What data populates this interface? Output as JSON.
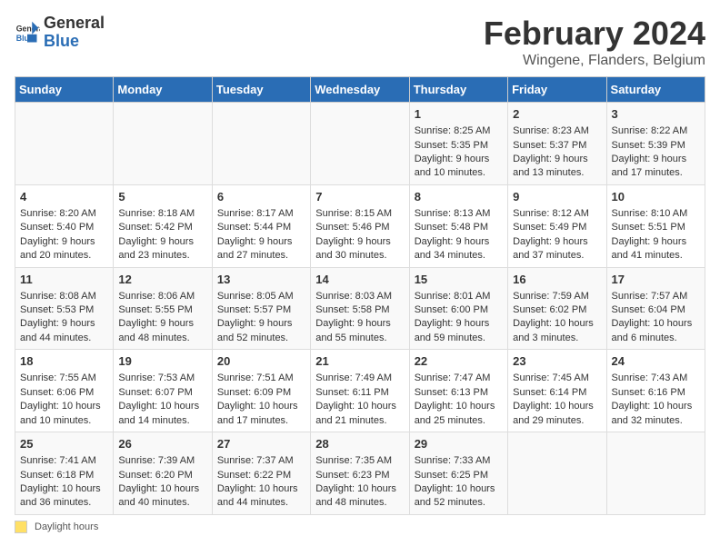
{
  "header": {
    "logo_general": "General",
    "logo_blue": "Blue",
    "title": "February 2024",
    "subtitle": "Wingene, Flanders, Belgium"
  },
  "columns": [
    "Sunday",
    "Monday",
    "Tuesday",
    "Wednesday",
    "Thursday",
    "Friday",
    "Saturday"
  ],
  "weeks": [
    {
      "days": [
        {
          "num": "",
          "info": ""
        },
        {
          "num": "",
          "info": ""
        },
        {
          "num": "",
          "info": ""
        },
        {
          "num": "",
          "info": ""
        },
        {
          "num": "1",
          "info": "Sunrise: 8:25 AM\nSunset: 5:35 PM\nDaylight: 9 hours and 10 minutes."
        },
        {
          "num": "2",
          "info": "Sunrise: 8:23 AM\nSunset: 5:37 PM\nDaylight: 9 hours and 13 minutes."
        },
        {
          "num": "3",
          "info": "Sunrise: 8:22 AM\nSunset: 5:39 PM\nDaylight: 9 hours and 17 minutes."
        }
      ]
    },
    {
      "days": [
        {
          "num": "4",
          "info": "Sunrise: 8:20 AM\nSunset: 5:40 PM\nDaylight: 9 hours and 20 minutes."
        },
        {
          "num": "5",
          "info": "Sunrise: 8:18 AM\nSunset: 5:42 PM\nDaylight: 9 hours and 23 minutes."
        },
        {
          "num": "6",
          "info": "Sunrise: 8:17 AM\nSunset: 5:44 PM\nDaylight: 9 hours and 27 minutes."
        },
        {
          "num": "7",
          "info": "Sunrise: 8:15 AM\nSunset: 5:46 PM\nDaylight: 9 hours and 30 minutes."
        },
        {
          "num": "8",
          "info": "Sunrise: 8:13 AM\nSunset: 5:48 PM\nDaylight: 9 hours and 34 minutes."
        },
        {
          "num": "9",
          "info": "Sunrise: 8:12 AM\nSunset: 5:49 PM\nDaylight: 9 hours and 37 minutes."
        },
        {
          "num": "10",
          "info": "Sunrise: 8:10 AM\nSunset: 5:51 PM\nDaylight: 9 hours and 41 minutes."
        }
      ]
    },
    {
      "days": [
        {
          "num": "11",
          "info": "Sunrise: 8:08 AM\nSunset: 5:53 PM\nDaylight: 9 hours and 44 minutes."
        },
        {
          "num": "12",
          "info": "Sunrise: 8:06 AM\nSunset: 5:55 PM\nDaylight: 9 hours and 48 minutes."
        },
        {
          "num": "13",
          "info": "Sunrise: 8:05 AM\nSunset: 5:57 PM\nDaylight: 9 hours and 52 minutes."
        },
        {
          "num": "14",
          "info": "Sunrise: 8:03 AM\nSunset: 5:58 PM\nDaylight: 9 hours and 55 minutes."
        },
        {
          "num": "15",
          "info": "Sunrise: 8:01 AM\nSunset: 6:00 PM\nDaylight: 9 hours and 59 minutes."
        },
        {
          "num": "16",
          "info": "Sunrise: 7:59 AM\nSunset: 6:02 PM\nDaylight: 10 hours and 3 minutes."
        },
        {
          "num": "17",
          "info": "Sunrise: 7:57 AM\nSunset: 6:04 PM\nDaylight: 10 hours and 6 minutes."
        }
      ]
    },
    {
      "days": [
        {
          "num": "18",
          "info": "Sunrise: 7:55 AM\nSunset: 6:06 PM\nDaylight: 10 hours and 10 minutes."
        },
        {
          "num": "19",
          "info": "Sunrise: 7:53 AM\nSunset: 6:07 PM\nDaylight: 10 hours and 14 minutes."
        },
        {
          "num": "20",
          "info": "Sunrise: 7:51 AM\nSunset: 6:09 PM\nDaylight: 10 hours and 17 minutes."
        },
        {
          "num": "21",
          "info": "Sunrise: 7:49 AM\nSunset: 6:11 PM\nDaylight: 10 hours and 21 minutes."
        },
        {
          "num": "22",
          "info": "Sunrise: 7:47 AM\nSunset: 6:13 PM\nDaylight: 10 hours and 25 minutes."
        },
        {
          "num": "23",
          "info": "Sunrise: 7:45 AM\nSunset: 6:14 PM\nDaylight: 10 hours and 29 minutes."
        },
        {
          "num": "24",
          "info": "Sunrise: 7:43 AM\nSunset: 6:16 PM\nDaylight: 10 hours and 32 minutes."
        }
      ]
    },
    {
      "days": [
        {
          "num": "25",
          "info": "Sunrise: 7:41 AM\nSunset: 6:18 PM\nDaylight: 10 hours and 36 minutes."
        },
        {
          "num": "26",
          "info": "Sunrise: 7:39 AM\nSunset: 6:20 PM\nDaylight: 10 hours and 40 minutes."
        },
        {
          "num": "27",
          "info": "Sunrise: 7:37 AM\nSunset: 6:22 PM\nDaylight: 10 hours and 44 minutes."
        },
        {
          "num": "28",
          "info": "Sunrise: 7:35 AM\nSunset: 6:23 PM\nDaylight: 10 hours and 48 minutes."
        },
        {
          "num": "29",
          "info": "Sunrise: 7:33 AM\nSunset: 6:25 PM\nDaylight: 10 hours and 52 minutes."
        },
        {
          "num": "",
          "info": ""
        },
        {
          "num": "",
          "info": ""
        }
      ]
    }
  ],
  "footer": {
    "daylight_label": "Daylight hours"
  }
}
